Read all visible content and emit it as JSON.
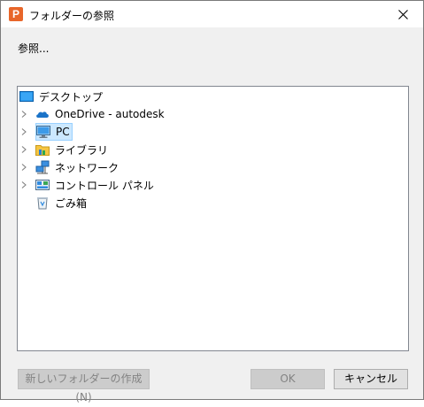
{
  "window": {
    "title": "フォルダーの参照",
    "app_icon_letter": "P",
    "close_icon": "close-icon"
  },
  "prompt": "参照...",
  "tree": {
    "root": {
      "label": "デスクトップ",
      "icon": "desktop-icon"
    },
    "items": [
      {
        "label": "OneDrive - autodesk",
        "icon": "onedrive-cloud-icon",
        "expandable": true
      },
      {
        "label": "PC",
        "icon": "pc-monitor-icon",
        "expandable": true,
        "selected": true
      },
      {
        "label": "ライブラリ",
        "icon": "library-icon",
        "expandable": true
      },
      {
        "label": "ネットワーク",
        "icon": "network-icon",
        "expandable": true
      },
      {
        "label": "コントロール パネル",
        "icon": "control-panel-icon",
        "expandable": true
      },
      {
        "label": "ごみ箱",
        "icon": "recycle-bin-icon",
        "expandable": false
      }
    ]
  },
  "buttons": {
    "new_folder": "新しいフォルダーの作成(N)",
    "ok": "OK",
    "cancel": "キャンセル"
  },
  "colors": {
    "selection_bg": "#cce8ff",
    "selection_border": "#99d1ff",
    "app_icon": "#e8662a",
    "folder_blue": "#1e88e5"
  }
}
